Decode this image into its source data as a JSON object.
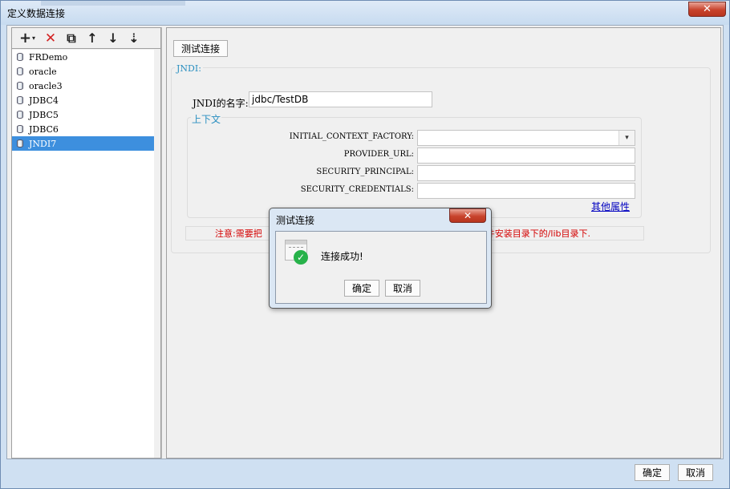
{
  "window": {
    "title": "定义数据连接",
    "close_glyph": "✕"
  },
  "toolbar": {
    "items": [
      {
        "name": "add-icon",
        "glyph": "+"
      },
      {
        "name": "delete-icon",
        "glyph": "✕"
      },
      {
        "name": "copy-icon",
        "glyph": "⧉"
      },
      {
        "name": "move-up-icon",
        "glyph": "↑"
      },
      {
        "name": "move-down-icon",
        "glyph": "↓"
      },
      {
        "name": "sort-icon",
        "glyph": "⇣"
      }
    ]
  },
  "connections": {
    "items": [
      "FRDemo",
      "oracle",
      "oracle3",
      "JDBC4",
      "JDBC5",
      "JDBC6",
      "JNDI7"
    ],
    "selected": "JNDI7"
  },
  "main": {
    "test_button": "测试连接",
    "jndi_section": "JNDI:",
    "jndi_name_label": "JNDI的名字:",
    "jndi_name_value": "jdbc/TestDB",
    "context_section": "上下文",
    "context_fields": {
      "initial_context_factory": "INITIAL_CONTEXT_FACTORY:",
      "provider_url": "PROVIDER_URL:",
      "security_principal": "SECURITY_PRINCIPAL:",
      "security_credentials": "SECURITY_CREDENTIALS:"
    },
    "dropdown_glyph": "▾",
    "other_properties_link": "其他属性",
    "note_left": "注意:需要把",
    "note_right": "文件安装目录下的/lib目录下."
  },
  "footer": {
    "ok": "确定",
    "cancel": "取消"
  },
  "dialog": {
    "title": "测试连接",
    "message": "连接成功!",
    "ok": "确定",
    "cancel": "取消",
    "close_glyph": "✕",
    "check_glyph": "✓",
    "accent_color": "#27b24a"
  },
  "colors": {
    "selection": "#3d8fde",
    "legend": "#2a8fc0",
    "note": "#d40000",
    "link": "#0000c0"
  }
}
